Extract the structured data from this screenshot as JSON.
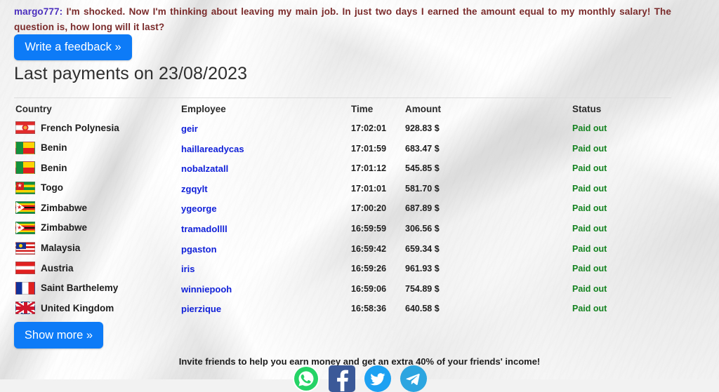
{
  "testimonial": {
    "username": "margo777:",
    "text": "I'm shocked. Now I'm thinking about leaving my main job. In just two days I earned the amount equal to my monthly salary! The question is, how long will it last?",
    "username_color": "#4b2fbe",
    "text_color": "#7a2b2b"
  },
  "buttons": {
    "write_feedback": "Write a feedback »",
    "show_more": "Show more »",
    "accent_color": "#0d7bf7"
  },
  "payments": {
    "title": "Last payments on 23/08/2023",
    "columns": {
      "country": "Country",
      "employee": "Employee",
      "time": "Time",
      "amount": "Amount",
      "status": "Status"
    },
    "status_color": "#13821f",
    "employee_link_color": "#1020d8",
    "rows": [
      {
        "flag": "pf",
        "country": "French Polynesia",
        "employee": "geir",
        "time": "17:02:01",
        "amount": "928.83 $",
        "status": "Paid out"
      },
      {
        "flag": "bj",
        "country": "Benin",
        "employee": "haillareadycas",
        "time": "17:01:59",
        "amount": "683.47 $",
        "status": "Paid out"
      },
      {
        "flag": "bj",
        "country": "Benin",
        "employee": "nobalzatall",
        "time": "17:01:12",
        "amount": "545.85 $",
        "status": "Paid out"
      },
      {
        "flag": "tg",
        "country": "Togo",
        "employee": "zgqylt",
        "time": "17:01:01",
        "amount": "581.70 $",
        "status": "Paid out"
      },
      {
        "flag": "zw",
        "country": "Zimbabwe",
        "employee": "ygeorge",
        "time": "17:00:20",
        "amount": "687.89 $",
        "status": "Paid out"
      },
      {
        "flag": "zw",
        "country": "Zimbabwe",
        "employee": "tramadollll",
        "time": "16:59:59",
        "amount": "306.56 $",
        "status": "Paid out"
      },
      {
        "flag": "my",
        "country": "Malaysia",
        "employee": "pgaston",
        "time": "16:59:42",
        "amount": "659.34 $",
        "status": "Paid out"
      },
      {
        "flag": "at",
        "country": "Austria",
        "employee": "iris",
        "time": "16:59:26",
        "amount": "961.93 $",
        "status": "Paid out"
      },
      {
        "flag": "bl",
        "country": "Saint Barthelemy",
        "employee": "winniepooh",
        "time": "16:59:06",
        "amount": "754.89 $",
        "status": "Paid out"
      },
      {
        "flag": "gb",
        "country": "United Kingdom",
        "employee": "pierzique",
        "time": "16:58:36",
        "amount": "640.58 $",
        "status": "Paid out"
      }
    ]
  },
  "footer": {
    "invite_text": "Invite friends to help you earn money and get an extra 40% of your friends' income!",
    "social": [
      {
        "name": "whatsapp-share-icon",
        "label": "WhatsApp",
        "color": "#25d366"
      },
      {
        "name": "facebook-share-icon",
        "label": "Facebook",
        "color": "#3b5998"
      },
      {
        "name": "twitter-share-icon",
        "label": "Twitter",
        "color": "#1da1f2"
      },
      {
        "name": "telegram-share-icon",
        "label": "Telegram",
        "color": "#2ca5e0"
      }
    ]
  }
}
